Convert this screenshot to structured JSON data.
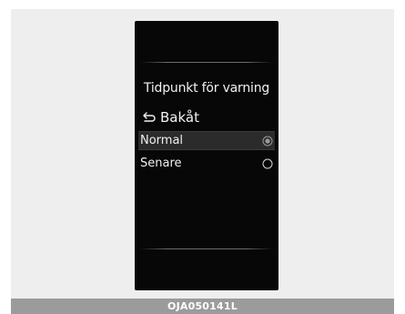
{
  "screen": {
    "title": "Tidpunkt för varning",
    "back_label": "Bakåt",
    "back_icon": "back-arrow-icon",
    "options": [
      {
        "label": "Normal",
        "selected": true
      },
      {
        "label": "Senare",
        "selected": false
      }
    ]
  },
  "caption": "OJA050141L",
  "colors": {
    "screen_background": "#070707",
    "frame_background": "#eeeeee",
    "caption_bar": "#9b9b9b",
    "selected_row": "#2b2b2b"
  }
}
